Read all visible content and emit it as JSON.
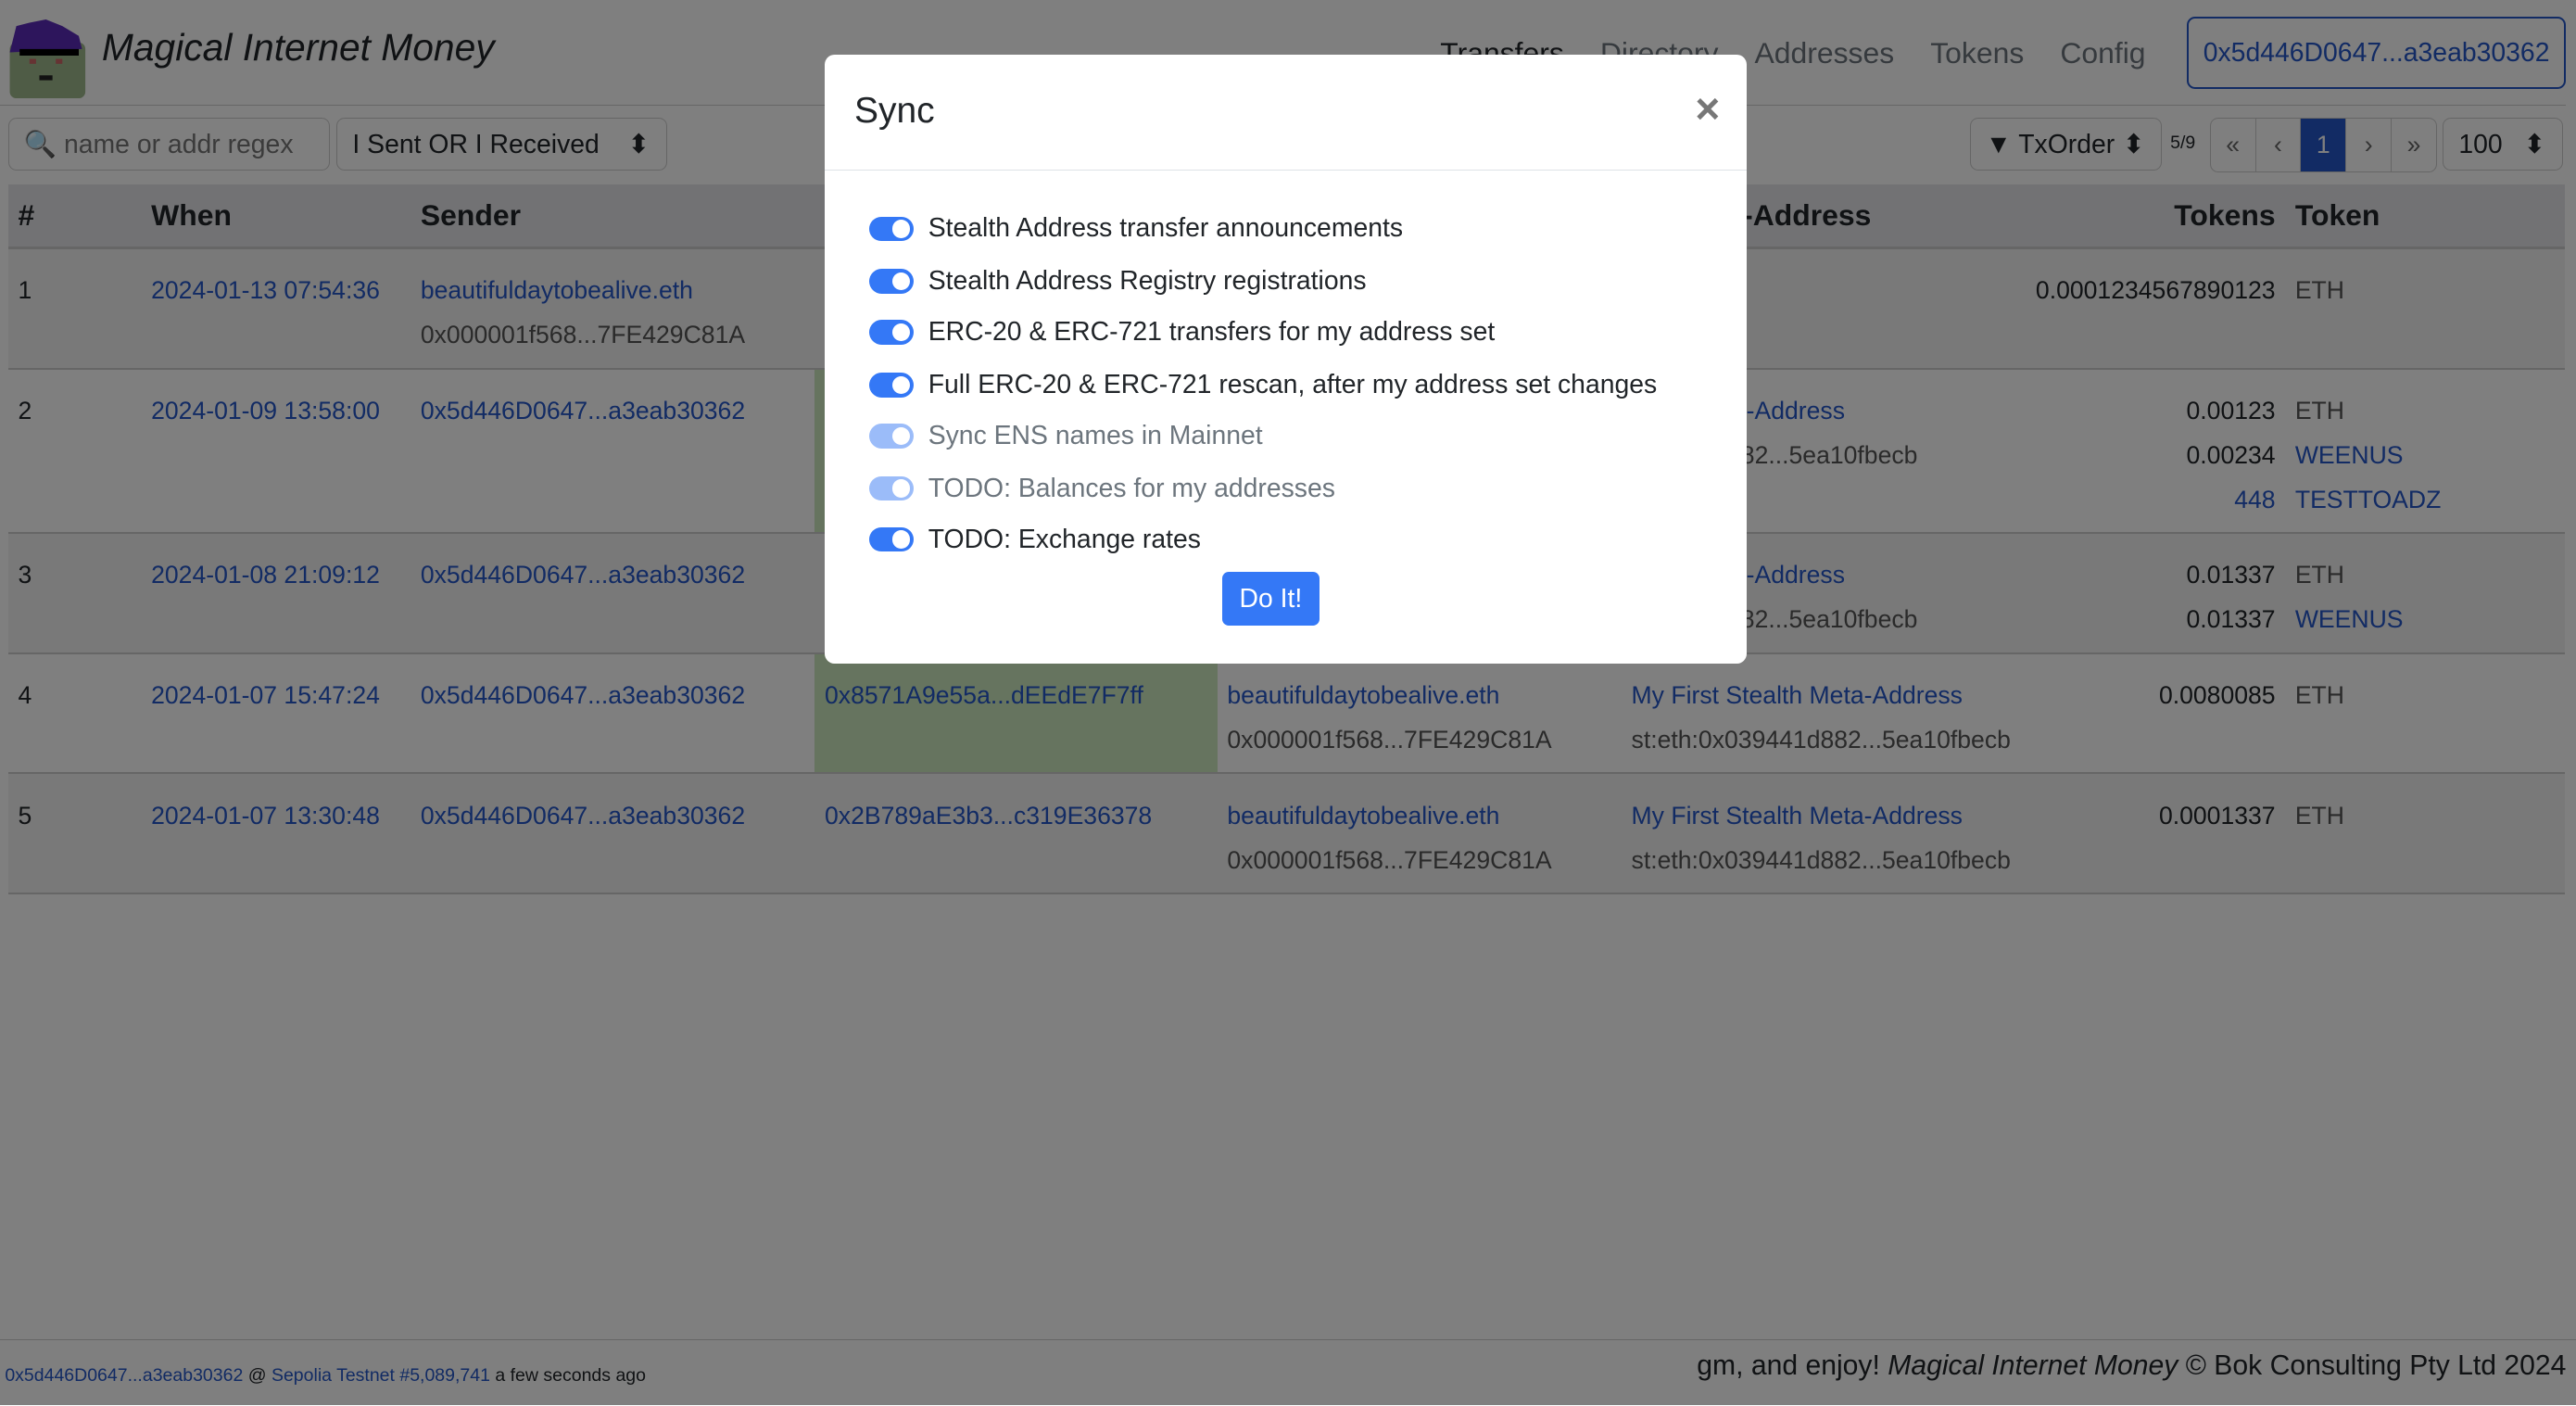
{
  "app": {
    "title": "Magical Internet Money"
  },
  "nav": {
    "items": [
      "Transfers",
      "Directory",
      "Addresses",
      "Tokens",
      "Config"
    ],
    "account": "0x5d446D0647...a3eab30362"
  },
  "toolbar": {
    "search_placeholder": "name or addr regex",
    "filter": "I Sent OR I Received",
    "sort": "▼ TxOrder",
    "page_info": "5/9",
    "pager": [
      "«",
      "‹",
      "1",
      "›",
      "»"
    ],
    "page_size": "100"
  },
  "table": {
    "headers": [
      "#",
      "When",
      "Sender",
      "",
      "",
      "lth Meta-Address",
      "Tokens",
      "Token"
    ],
    "rows": [
      {
        "n": "1",
        "when": "2024-01-13 07:54:36",
        "sender": "beautifuldaytobealive.eth",
        "sender_sub": "0x000001f568...7FE429C81A",
        "c4": "",
        "c5": "",
        "c5_sub": "",
        "meta": "",
        "meta_sub": "",
        "amounts": [
          "0.0001234567890123"
        ],
        "tokens": [
          "ETH"
        ]
      },
      {
        "n": "2",
        "when": "2024-01-09 13:58:00",
        "sender": "0x5d446D0647...a3eab30362",
        "sender_sub": "",
        "c4": "",
        "c5": "",
        "c5_sub": "",
        "meta": "ealth Meta-Address",
        "meta_sub": "039441d882...5ea10fbecb",
        "amounts": [
          "0.00123",
          "0.00234",
          "448"
        ],
        "tokens": [
          "ETH",
          "WEENUS",
          "TESTTOADZ"
        ]
      },
      {
        "n": "3",
        "when": "2024-01-08 21:09:12",
        "sender": "0x5d446D0647...a3eab30362",
        "sender_sub": "",
        "c4": "",
        "c5": "",
        "c5_sub": "",
        "meta": "ealth Meta-Address",
        "meta_sub": "039441d882...5ea10fbecb",
        "amounts": [
          "0.01337",
          "0.01337"
        ],
        "tokens": [
          "ETH",
          "WEENUS"
        ]
      },
      {
        "n": "4",
        "when": "2024-01-07 15:47:24",
        "sender": "0x5d446D0647...a3eab30362",
        "sender_sub": "",
        "c4": "0x8571A9e55a...dEEdE7F7ff",
        "c5": "beautifuldaytobealive.eth",
        "c5_sub": "0x000001f568...7FE429C81A",
        "meta": "My First Stealth Meta-Address",
        "meta_sub": "st:eth:0x039441d882...5ea10fbecb",
        "amounts": [
          "0.0080085"
        ],
        "tokens": [
          "ETH"
        ]
      },
      {
        "n": "5",
        "when": "2024-01-07 13:30:48",
        "sender": "0x5d446D0647...a3eab30362",
        "sender_sub": "",
        "c4": "0x2B789aE3b3...c319E36378",
        "c5": "beautifuldaytobealive.eth",
        "c5_sub": "0x000001f568...7FE429C81A",
        "meta": "My First Stealth Meta-Address",
        "meta_sub": "st:eth:0x039441d882...5ea10fbecb",
        "amounts": [
          "0.0001337"
        ],
        "tokens": [
          "ETH"
        ]
      }
    ]
  },
  "footer": {
    "account": "0x5d446D0647...a3eab30362",
    "at": "@",
    "network": "Sepolia Testnet #5,089,741",
    "time": "a few seconds ago",
    "credit_pre": "gm, and enjoy!",
    "credit_brand": "Magical Internet Money",
    "credit_post": "© Bok Consulting Pty Ltd 2024"
  },
  "modal": {
    "title": "Sync",
    "close": "×",
    "button": "Do It!",
    "options": [
      {
        "label": "Stealth Address transfer announcements",
        "on": true,
        "disabled": false
      },
      {
        "label": "Stealth Address Registry registrations",
        "on": true,
        "disabled": false
      },
      {
        "label": "ERC-20 & ERC-721 transfers for my address set",
        "on": true,
        "disabled": false
      },
      {
        "label": "Full ERC-20 & ERC-721 rescan, after my address set changes",
        "on": true,
        "disabled": false
      },
      {
        "label": "Sync ENS names in Mainnet",
        "on": true,
        "disabled": true
      },
      {
        "label": "TODO: Balances for my addresses",
        "on": true,
        "disabled": true
      },
      {
        "label": "TODO: Exchange rates",
        "on": true,
        "disabled": false
      }
    ]
  },
  "colors": {
    "accent": "#3478f6",
    "link": "#2456c8",
    "highlight": "#cce8be"
  }
}
